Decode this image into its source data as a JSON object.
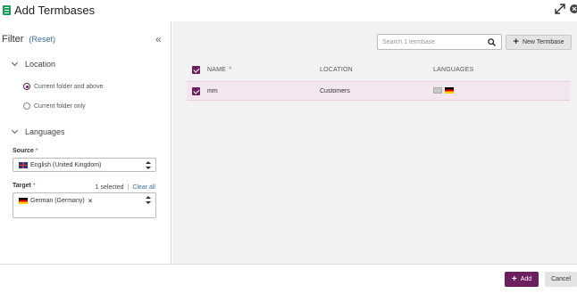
{
  "window": {
    "title": "Add Termbases",
    "icons": {
      "app": "termbase-app-icon",
      "expand": "expand-icon",
      "close": "close-icon"
    }
  },
  "filter": {
    "title": "Filter",
    "reset_open": "(",
    "reset_label": "Reset",
    "reset_close": ")",
    "collapse_icon": "double-chevron-left-icon",
    "location": {
      "heading": "Location",
      "options": [
        {
          "label": "Current folder and above",
          "selected": true
        },
        {
          "label": "Current folder only",
          "selected": false
        }
      ]
    },
    "languages": {
      "heading": "Languages",
      "source": {
        "label": "Source",
        "required_mark": "*",
        "value": "English (United Kingdom)"
      },
      "target": {
        "label": "Target",
        "required_mark": "*",
        "selected_count": "1 selected",
        "separator": "|",
        "clear_all": "Clear all",
        "tags": [
          {
            "label": "German (Germany)",
            "remove": "×"
          }
        ]
      }
    }
  },
  "main": {
    "search": {
      "placeholder": "Search 1 termbase",
      "value": ""
    },
    "new_termbase": {
      "plus": "+",
      "label": "New Termbase"
    },
    "table": {
      "headers": {
        "name": "NAME",
        "sort": "^",
        "location": "LOCATION",
        "languages": "LANGUAGES"
      },
      "rows": [
        {
          "name": "mm",
          "location": "Customers",
          "checked": true,
          "language_flags": [
            "generic-flag",
            "german-flag"
          ]
        }
      ]
    }
  },
  "footer": {
    "add": {
      "plus": "+",
      "label": "Add"
    },
    "cancel": "Cancel"
  },
  "colors": {
    "accent": "#6b1f5f",
    "row_highlight": "#f4e6ef",
    "link": "#3b6ea5",
    "panel_bg": "#f2f2f2"
  }
}
